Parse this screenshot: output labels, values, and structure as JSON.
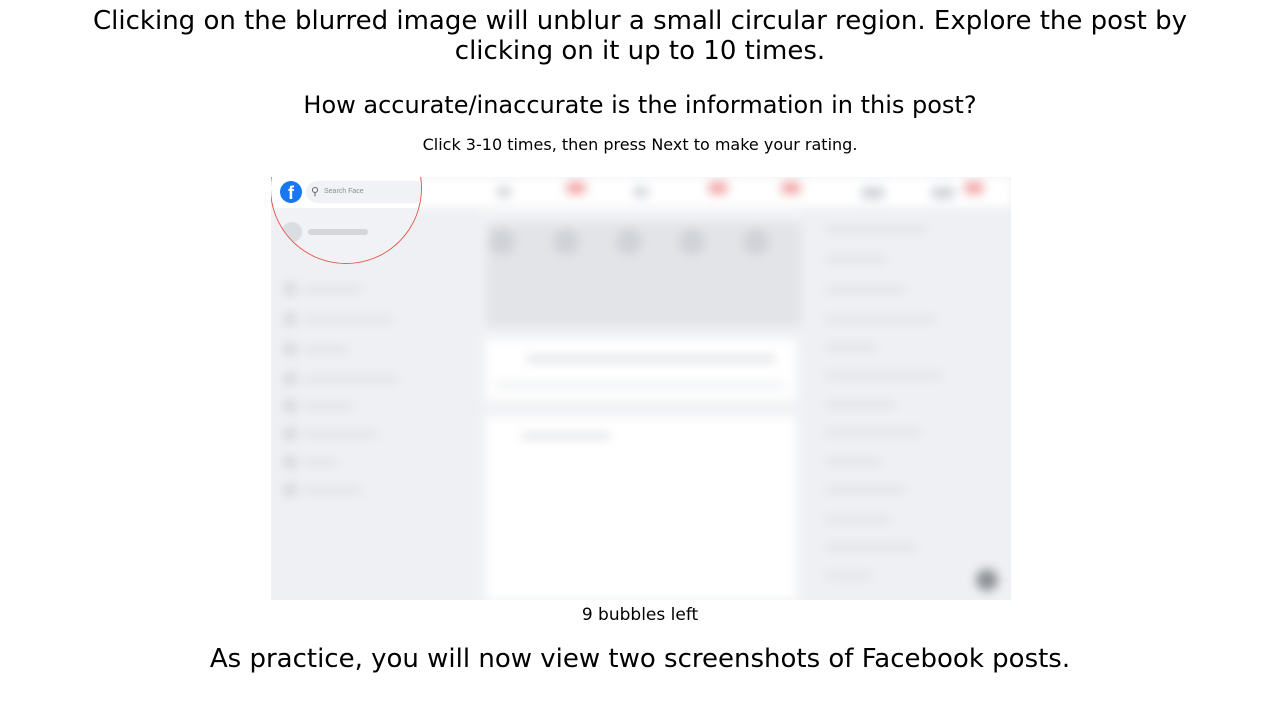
{
  "instructions": {
    "line1": "Clicking on the blurred image will unblur a small circular region. Explore the post by",
    "line2": "clicking on it up to 10 times."
  },
  "question": "How accurate/inaccurate is the information in this post?",
  "hint": "Click 3-10 times, then press Next to make your rating.",
  "screenshot": {
    "logo_letter": "f",
    "search_icon": "search-icon",
    "search_placeholder": "Search Face",
    "reveal_border_color": "#e5584f",
    "brand_color": "#1877f2"
  },
  "bubbles_left": "9 bubbles left",
  "footer": "As practice, you will now view two screenshots of Facebook posts."
}
